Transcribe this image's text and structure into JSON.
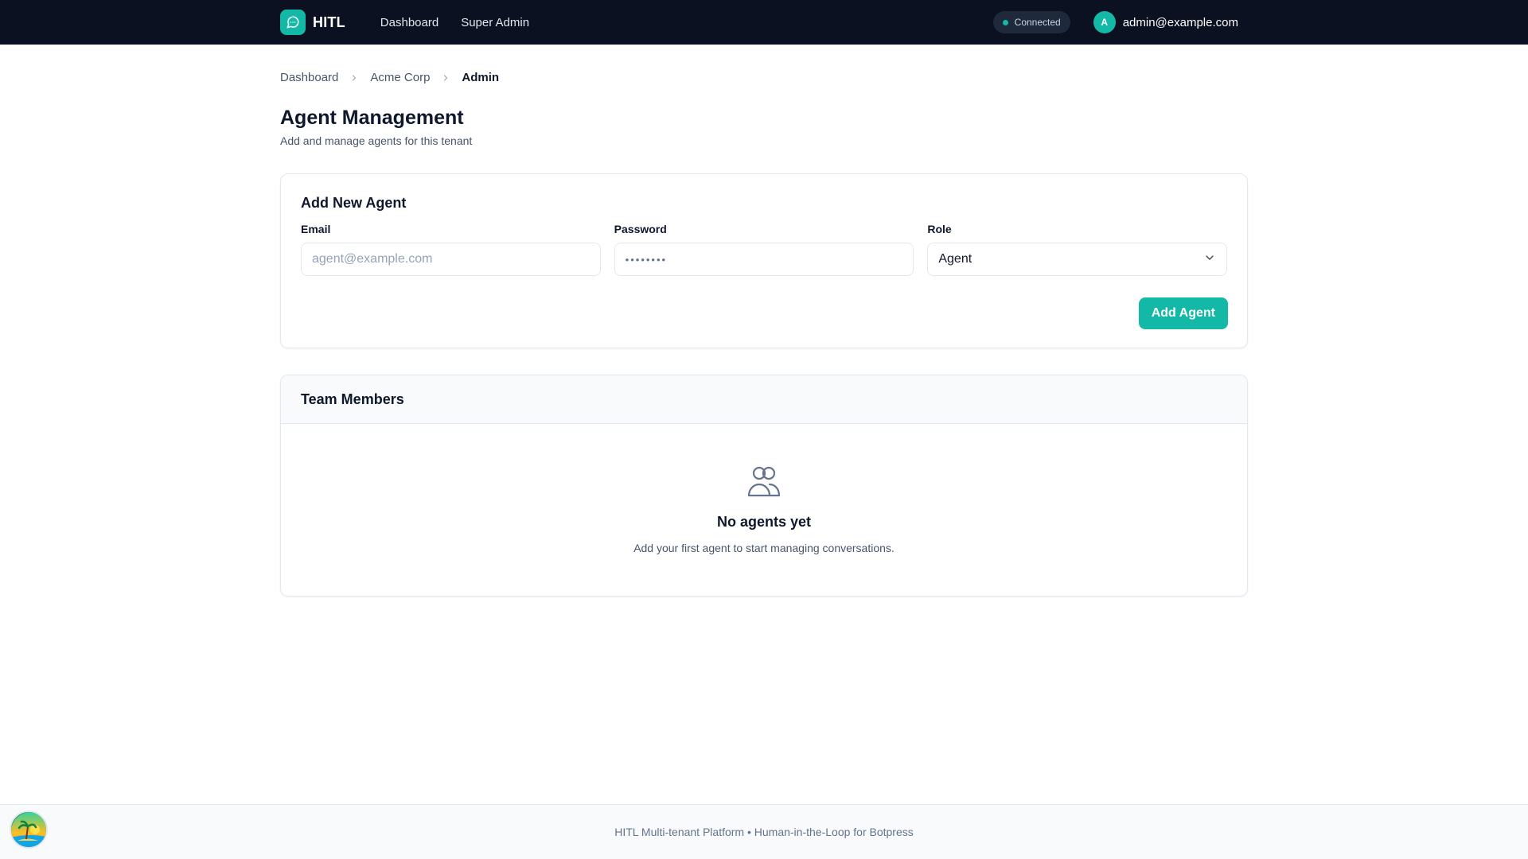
{
  "nav": {
    "brand": "HITL",
    "links": [
      "Dashboard",
      "Super Admin"
    ],
    "status": "Connected",
    "user_initial": "A",
    "user_email": "admin@example.com"
  },
  "breadcrumb": [
    "Dashboard",
    "Acme Corp",
    "Admin"
  ],
  "page": {
    "title": "Agent Management",
    "subtitle": "Add and manage agents for this tenant"
  },
  "add_agent": {
    "title": "Add New Agent",
    "email_label": "Email",
    "email_placeholder": "agent@example.com",
    "password_label": "Password",
    "password_value": "••••••••",
    "role_label": "Role",
    "role_value": "Agent",
    "submit_label": "Add Agent"
  },
  "team": {
    "title": "Team Members",
    "empty_title": "No agents yet",
    "empty_desc": "Add your first agent to start managing conversations."
  },
  "footer": {
    "text": "HITL Multi-tenant Platform • Human-in-the-Loop for Botpress"
  },
  "colors": {
    "nav_bg": "#0b1120",
    "accent": "#14b8a6",
    "text": "#0f172a",
    "muted": "#475569",
    "border": "#e2e8f0"
  },
  "icons": {
    "brand": "chat-bubble-icon",
    "breadcrumb_separator": "chevron-right-icon",
    "select": "chevron-down-icon",
    "empty_state": "users-icon",
    "floating": "island-badge-icon"
  }
}
